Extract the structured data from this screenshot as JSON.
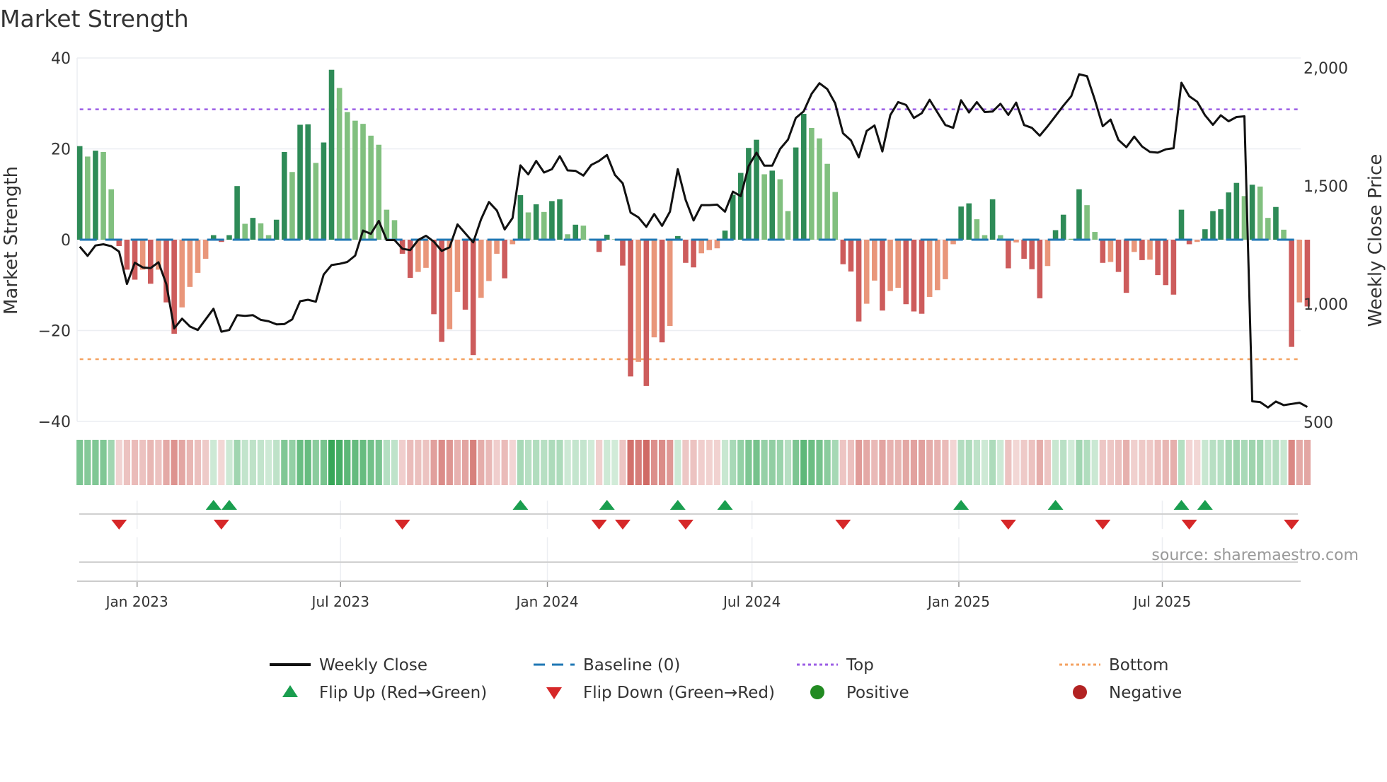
{
  "chart_data": {
    "type": "bar",
    "title": "Market Strength",
    "ylabel": "Market Strength",
    "y2label": "Weekly Close Price",
    "ylim": [
      -40,
      40
    ],
    "y2lim": [
      500,
      2000
    ],
    "yticks": [
      "40",
      "20",
      "0",
      "−20",
      "−40"
    ],
    "ytick_values": [
      40,
      20,
      0,
      -20,
      -40
    ],
    "y2ticks": [
      "2,000",
      "1,500",
      "1,000",
      "500"
    ],
    "y2tick_values": [
      2000,
      1500,
      1000,
      500
    ],
    "x_start": "2022-11-11",
    "x_step_days": 7,
    "xticks": [
      {
        "label": "Jan 2023",
        "date": "2023-01-01"
      },
      {
        "label": "Jul 2023",
        "date": "2023-07-01"
      },
      {
        "label": "Jan 2024",
        "date": "2024-01-01"
      },
      {
        "label": "Jul 2024",
        "date": "2024-07-01"
      },
      {
        "label": "Jan 2025",
        "date": "2025-01-01"
      },
      {
        "label": "Jul 2025",
        "date": "2025-07-01"
      }
    ],
    "top_level": 28.7,
    "bottom_level": -26.3,
    "baseline": 0,
    "grid": true,
    "strength": [
      20.6,
      18.3,
      19.6,
      19.3,
      11.1,
      -1.4,
      -6.6,
      -8.8,
      -6.6,
      -9.7,
      -6.6,
      -13.8,
      -20.7,
      -14.9,
      -10.4,
      -7.3,
      -4.2,
      1.0,
      -0.5,
      1.0,
      11.8,
      3.5,
      4.8,
      3.6,
      1.0,
      4.4,
      19.3,
      14.9,
      25.3,
      25.4,
      16.9,
      21.4,
      37.4,
      33.4,
      28.1,
      26.2,
      25.5,
      22.9,
      20.9,
      6.6,
      4.3,
      -3.1,
      -8.4,
      -7.1,
      -6.2,
      -16.4,
      -22.5,
      -19.7,
      -11.5,
      -15.4,
      -25.4,
      -12.8,
      -9.1,
      -3.1,
      -8.5,
      -1.0,
      9.8,
      6.0,
      7.8,
      6.1,
      8.5,
      8.9,
      1.2,
      3.3,
      3.1,
      0.2,
      -2.7,
      1.1,
      0.1,
      -5.7,
      -30.1,
      -26.9,
      -32.2,
      -21.5,
      -22.6,
      -19.0,
      0.8,
      -5.1,
      -6.1,
      -3.0,
      -2.3,
      -1.9,
      2.0,
      9.9,
      14.7,
      20.2,
      22.0,
      14.4,
      15.2,
      13.3,
      6.3,
      20.3,
      27.7,
      24.6,
      22.3,
      16.7,
      10.5,
      -5.4,
      -7.0,
      -18.0,
      -14.1,
      -9.0,
      -15.6,
      -11.3,
      -10.6,
      -14.2,
      -15.8,
      -16.3,
      -12.6,
      -11.1,
      -8.7,
      -1.0,
      7.3,
      8.0,
      4.5,
      1.0,
      8.9,
      1.0,
      -6.3,
      -0.6,
      -4.2,
      -6.5,
      -12.9,
      -5.8,
      2.1,
      5.5,
      0.2,
      11.1,
      7.6,
      1.7,
      -5.1,
      -4.9,
      -7.1,
      -11.7,
      -2.7,
      -4.5,
      -4.4,
      -7.8,
      -10.0,
      -12.1,
      6.6,
      -1.0,
      -0.5,
      2.3,
      6.3,
      6.7,
      10.4,
      12.5,
      9.6,
      12.1,
      11.7,
      4.8,
      7.2,
      2.2,
      -23.6,
      -13.8,
      -14.7
    ],
    "weekly_close": [
      1243,
      1204,
      1248,
      1253,
      1245,
      1222,
      1085,
      1175,
      1155,
      1152,
      1177,
      1085,
      897,
      938,
      905,
      890,
      935,
      980,
      883,
      890,
      953,
      950,
      953,
      933,
      927,
      914,
      915,
      935,
      1012,
      1018,
      1010,
      1125,
      1165,
      1170,
      1178,
      1205,
      1311,
      1297,
      1352,
      1271,
      1271,
      1234,
      1228,
      1271,
      1289,
      1264,
      1225,
      1240,
      1337,
      1299,
      1261,
      1359,
      1432,
      1396,
      1316,
      1364,
      1587,
      1549,
      1606,
      1557,
      1571,
      1626,
      1566,
      1564,
      1544,
      1589,
      1606,
      1631,
      1547,
      1511,
      1387,
      1367,
      1327,
      1381,
      1331,
      1391,
      1571,
      1441,
      1354,
      1419,
      1419,
      1421,
      1391,
      1476,
      1457,
      1584,
      1641,
      1586,
      1586,
      1657,
      1696,
      1788,
      1816,
      1890,
      1935,
      1910,
      1850,
      1723,
      1693,
      1621,
      1733,
      1756,
      1646,
      1800,
      1855,
      1843,
      1788,
      1808,
      1865,
      1811,
      1758,
      1746,
      1863,
      1811,
      1855,
      1813,
      1815,
      1848,
      1801,
      1853,
      1758,
      1746,
      1713,
      1753,
      1796,
      1840,
      1880,
      1973,
      1965,
      1864,
      1753,
      1781,
      1695,
      1664,
      1709,
      1667,
      1644,
      1641,
      1655,
      1660,
      1937,
      1880,
      1857,
      1799,
      1759,
      1799,
      1774,
      1792,
      1795,
      588,
      585,
      562,
      587,
      572,
      577,
      582,
      564
    ],
    "legend": [
      {
        "label": "Weekly Close",
        "symbol": "line",
        "color": "#111111"
      },
      {
        "label": "Baseline (0)",
        "symbol": "dash",
        "color": "#1f77b4"
      },
      {
        "label": "Top",
        "symbol": "dot",
        "color": "#9b5de5"
      },
      {
        "label": "Bottom",
        "symbol": "dot",
        "color": "#f4a261"
      },
      {
        "label": "Flip Up (Red→Green)",
        "symbol": "triangle-up",
        "color": "#1a9e4f"
      },
      {
        "label": "Flip Down (Green→Red)",
        "symbol": "triangle-down",
        "color": "#d62728"
      },
      {
        "label": "Positive",
        "symbol": "circle",
        "color": "#228b22"
      },
      {
        "label": "Negative",
        "symbol": "circle",
        "color": "#b22222"
      }
    ],
    "legend_position": "bottom",
    "source": "source: sharemaestro.com",
    "colors": {
      "pos_strong": "#2e8b57",
      "pos_weak": "#81c07f",
      "neg_strong": "#cd5c5c",
      "neg_weak": "#e9967a",
      "strip_pos": "#2ca24f",
      "strip_neg": "#c8504a"
    }
  }
}
